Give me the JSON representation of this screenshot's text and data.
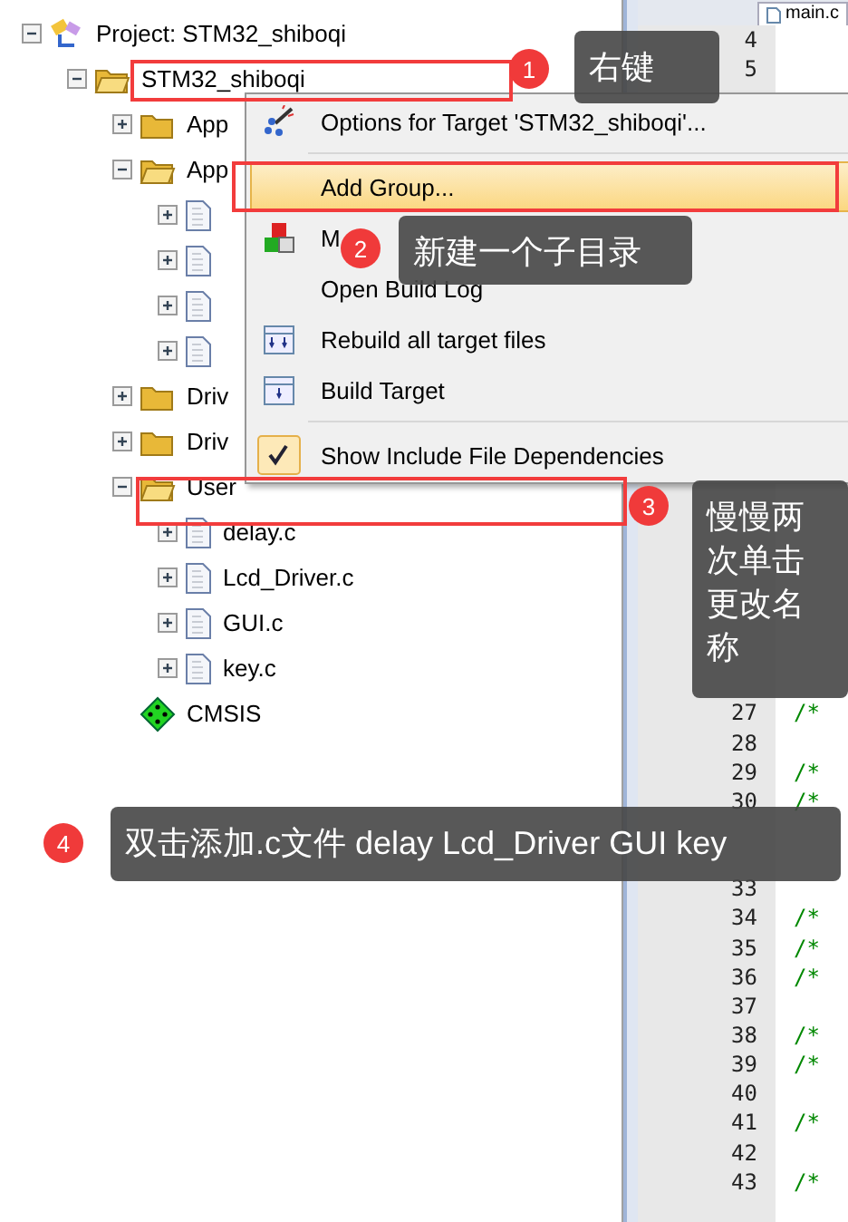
{
  "tab": {
    "label": "main.c"
  },
  "tree": {
    "kind": "project",
    "label": "Project: STM32_shiboqi",
    "expanded": true,
    "children": [
      {
        "kind": "target",
        "label": "STM32_shiboqi",
        "expanded": true,
        "children": [
          {
            "kind": "group",
            "label": "App",
            "expanded": false
          },
          {
            "kind": "group",
            "label": "App",
            "expanded": true,
            "children": [
              {
                "kind": "file",
                "expanded": false
              },
              {
                "kind": "file",
                "expanded": false
              },
              {
                "kind": "file",
                "expanded": false
              },
              {
                "kind": "file",
                "expanded": false
              }
            ]
          },
          {
            "kind": "group",
            "label": "Driv",
            "expanded": false
          },
          {
            "kind": "group",
            "label": "Driv",
            "expanded": false
          },
          {
            "kind": "group",
            "label": "User",
            "expanded": true,
            "children": [
              {
                "kind": "file",
                "label": "delay.c",
                "expanded": false
              },
              {
                "kind": "file",
                "label": "Lcd_Driver.c",
                "expanded": false
              },
              {
                "kind": "file",
                "label": "GUI.c",
                "expanded": false
              },
              {
                "kind": "file",
                "label": "key.c",
                "expanded": false
              }
            ]
          },
          {
            "kind": "component",
            "label": "CMSIS"
          }
        ]
      }
    ]
  },
  "menu": {
    "sections": [
      [
        {
          "kind": "options",
          "label": "Options for Target 'STM32_shiboqi'...",
          "selected": false,
          "checked": false
        }
      ],
      [
        {
          "kind": "plain",
          "label": "Add Group...",
          "selected": true,
          "checked": false
        },
        {
          "kind": "manage",
          "label": "M",
          "selected": false,
          "checked": false
        },
        {
          "kind": "plain",
          "label": "Open Build Log",
          "selected": false,
          "checked": false
        },
        {
          "kind": "rebuild",
          "label": "Rebuild all target files",
          "selected": false,
          "checked": false
        },
        {
          "kind": "build",
          "label": "Build Target",
          "selected": false,
          "checked": false
        }
      ],
      [
        {
          "kind": "plain",
          "label": "Show Include File Dependencies",
          "selected": false,
          "checked": true
        }
      ]
    ]
  },
  "editor": {
    "lines_top": [
      {
        "number": "4"
      },
      {
        "number": "5"
      }
    ],
    "lines_middle": [
      {
        "number": "27",
        "code": "/*"
      },
      {
        "number": "28"
      },
      {
        "number": "29",
        "code": "/*"
      },
      {
        "number": "30",
        "code": "/*"
      }
    ],
    "lines_bottom": [
      {
        "number": "33"
      },
      {
        "number": "34",
        "code": "/*"
      },
      {
        "number": "35",
        "code": "/*"
      },
      {
        "number": "36",
        "code": "/*"
      },
      {
        "number": "37"
      },
      {
        "number": "38",
        "code": "/*"
      },
      {
        "number": "39",
        "code": "/*"
      },
      {
        "number": "40"
      },
      {
        "number": "41",
        "code": "/*"
      },
      {
        "number": "42"
      },
      {
        "number": "43",
        "code": "/*"
      }
    ]
  },
  "annotations": [
    {
      "number": "1",
      "text": "右键"
    },
    {
      "number": "2",
      "text": "新建一个子目录"
    },
    {
      "number": "3",
      "text": "慢慢两次单击更改名称"
    },
    {
      "number": "4",
      "text": "双击添加.c文件 delay Lcd_Driver GUI key"
    }
  ]
}
